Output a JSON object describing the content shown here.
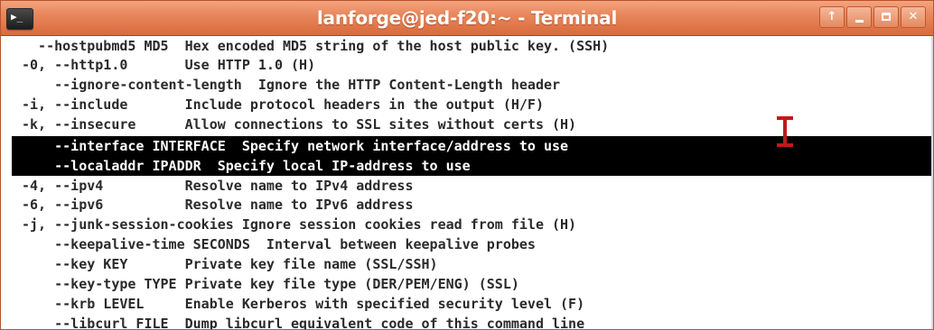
{
  "window": {
    "title": "lanforge@jed-f20:~ - Terminal",
    "app_icon_glyph": "▶_",
    "controls": {
      "up_label": "↑",
      "minimize_label": "",
      "maximize_label": "",
      "close_label": "✕"
    }
  },
  "terminal": {
    "lines": [
      "  --hostpubmd5 MD5  Hex encoded MD5 string of the host public key. (SSH)",
      "-0, --http1.0       Use HTTP 1.0 (H)",
      "    --ignore-content-length  Ignore the HTTP Content-Length header",
      "-i, --include       Include protocol headers in the output (H/F)",
      "-k, --insecure      Allow connections to SSL sites without certs (H)",
      "    --interface INTERFACE  Specify network interface/address to use",
      "    --localaddr IPADDR  Specify local IP-address to use",
      "-4, --ipv4          Resolve name to IPv4 address",
      "-6, --ipv6          Resolve name to IPv6 address",
      "-j, --junk-session-cookies Ignore session cookies read from file (H)",
      "    --keepalive-time SECONDS  Interval between keepalive probes",
      "    --key KEY       Private key file name (SSL/SSH)",
      "    --key-type TYPE Private key file type (DER/PEM/ENG) (SSL)",
      "    --krb LEVEL     Enable Kerberos with specified security level (F)",
      "    --libcurl FILE  Dump libcurl equivalent code of this command line"
    ],
    "selected_lines": [
      5,
      6
    ]
  },
  "colors": {
    "titlebar": "#e8875c",
    "text": "#2a2a2a",
    "selection_bg": "#000000",
    "selection_fg": "#ffffff",
    "cursor": "#c21818"
  },
  "icons": {
    "app": "terminal-icon",
    "up": "arrow-up-icon",
    "minimize": "minimize-icon",
    "maximize": "maximize-icon",
    "close": "close-icon",
    "cursor": "text-cursor-icon"
  }
}
